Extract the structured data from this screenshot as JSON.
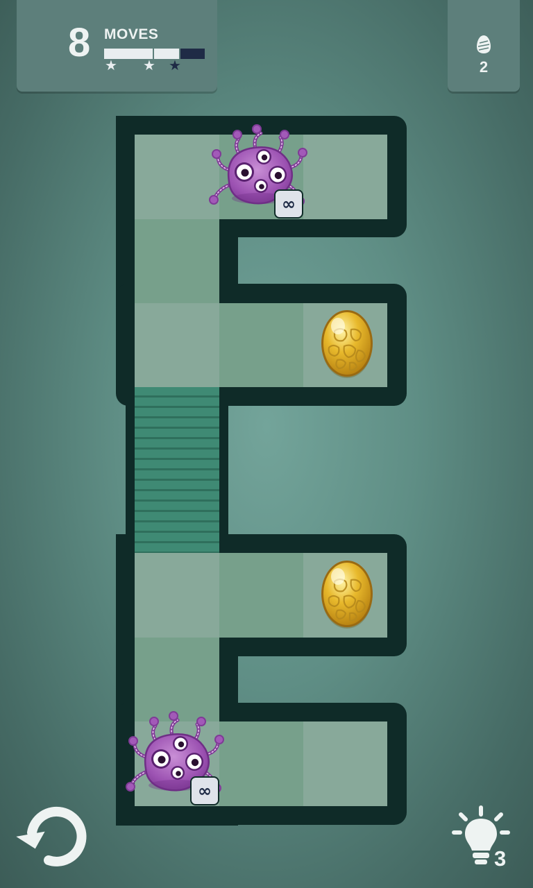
{
  "hud": {
    "moves_count": "8",
    "moves_label": "MOVES",
    "moves_progress": 0.75,
    "stars": 3,
    "eggs_count": "2",
    "egg_icon": "egg-outline-icon"
  },
  "controls": {
    "undo_icon": "undo-icon",
    "hint_icon": "lightbulb-icon",
    "hint_count": "3"
  },
  "board": {
    "monsters": [
      {
        "name": "purple-monster",
        "badge": "∞"
      },
      {
        "name": "purple-monster",
        "badge": "∞"
      }
    ],
    "eggs": [
      {
        "name": "golden-egg"
      },
      {
        "name": "golden-egg"
      }
    ],
    "water_tile": "water-channel"
  },
  "colors": {
    "background": "#5f8e85",
    "wall": "#0f2b28",
    "tile_light": "#88a99a",
    "tile_dark": "#77a08b",
    "water": "#3d8672",
    "monster": "#a25ab8",
    "egg": "#e7b82a",
    "panel": "#5d7f7b"
  }
}
